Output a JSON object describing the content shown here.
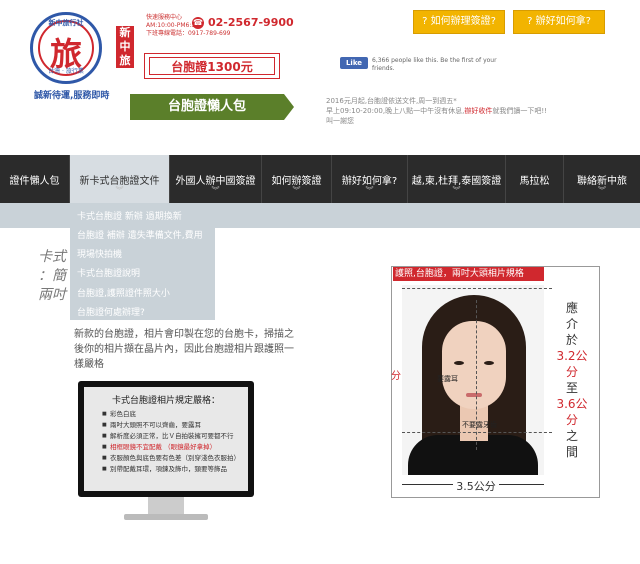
{
  "header": {
    "logo": {
      "char": "旅",
      "arc_top": "新中旅行社",
      "arc_bottom": "台灣 · 旅行業",
      "slogan": "誠新待運,服務即時"
    },
    "badge": "新中旅",
    "contact_lines": [
      "快速服務中心",
      "AM:10:00-PM6:30",
      "下班專線電話：0917-789-699"
    ],
    "phone": "02-2567-9900",
    "price_label": "台胞證1300元",
    "banner": "台胞證懶人包",
    "buttons": [
      "? 如何辦理簽證?",
      "? 辦好如何拿?"
    ],
    "fb": {
      "like": "Like",
      "text": "6,366 people like this. Be the first of your friends."
    },
    "notice": {
      "line1": "2016元月起,台胞證依送文件,周一到週五*",
      "line2_pre": "早上09:10-20:00,晚上八點一中午沒有休息,",
      "line2_hl": "辦好收件",
      "line2_post": "就我們讀一下吧!!",
      "line3": "叫一謝您"
    }
  },
  "nav": {
    "items": [
      {
        "label": "證件懶人包"
      },
      {
        "label": "新卡式台胞證文件"
      },
      {
        "label": "外國人辦中國簽證"
      },
      {
        "label": "如何辦簽證"
      },
      {
        "label": "辦好如何拿?"
      },
      {
        "label": "越,柬,杜拜,泰國簽證"
      },
      {
        "label": "馬拉松"
      },
      {
        "label": "聯絡新中旅"
      }
    ],
    "chevron": "︾"
  },
  "dropdown": {
    "items": [
      "卡式台胞證 新辦 過期換新",
      "台胞證 補辦 遺失準備文件,費用",
      "現場快拍機",
      "卡式台胞證說明",
      "台胞證,護照證件照大小",
      "台胞證何處辦理?"
    ]
  },
  "content": {
    "side_heading_lines": [
      "卡式",
      "：簡",
      "兩吋"
    ],
    "description": "新款的台胞證，相片會印製在您的台胞卡，掃描之後你的相片擷在晶片內，因此台胞證相片跟護照一樣嚴格",
    "monitor": {
      "title": "卡式台胞證相片規定嚴格：",
      "items": [
        {
          "text": "彩色白底",
          "red": false
        },
        {
          "text": "兩吋大頭照不可以齊齒，要露耳",
          "red": false
        },
        {
          "text": "解析度必須正常，比Ｖ自拍裝擁可要都不行",
          "red": false
        },
        {
          "text": "相框眼鏡不宜配戴 （眼鏡最好拿掉）",
          "red": true
        },
        {
          "text": "衣服顏色與底色要有色差（別穿淺色衣服拍）",
          "red": false
        },
        {
          "text": "別帶配戴耳環，項鍊及飾巾，頸要等飾品",
          "red": false
        }
      ]
    },
    "photo_spec": {
      "title": "護照,台胞證，兩吋大頭相片規格",
      "annotations": {
        "ear": "要露耳",
        "teeth": "不要露牙齒"
      },
      "right_note": {
        "line1": "應",
        "line2": "介",
        "line3": "於",
        "value1": "3.2公分",
        "line4": "至",
        "value2": "3.6公分",
        "line5": "之",
        "line6": "間"
      },
      "width_label": "3.5公分",
      "left_cut": "分"
    }
  }
}
